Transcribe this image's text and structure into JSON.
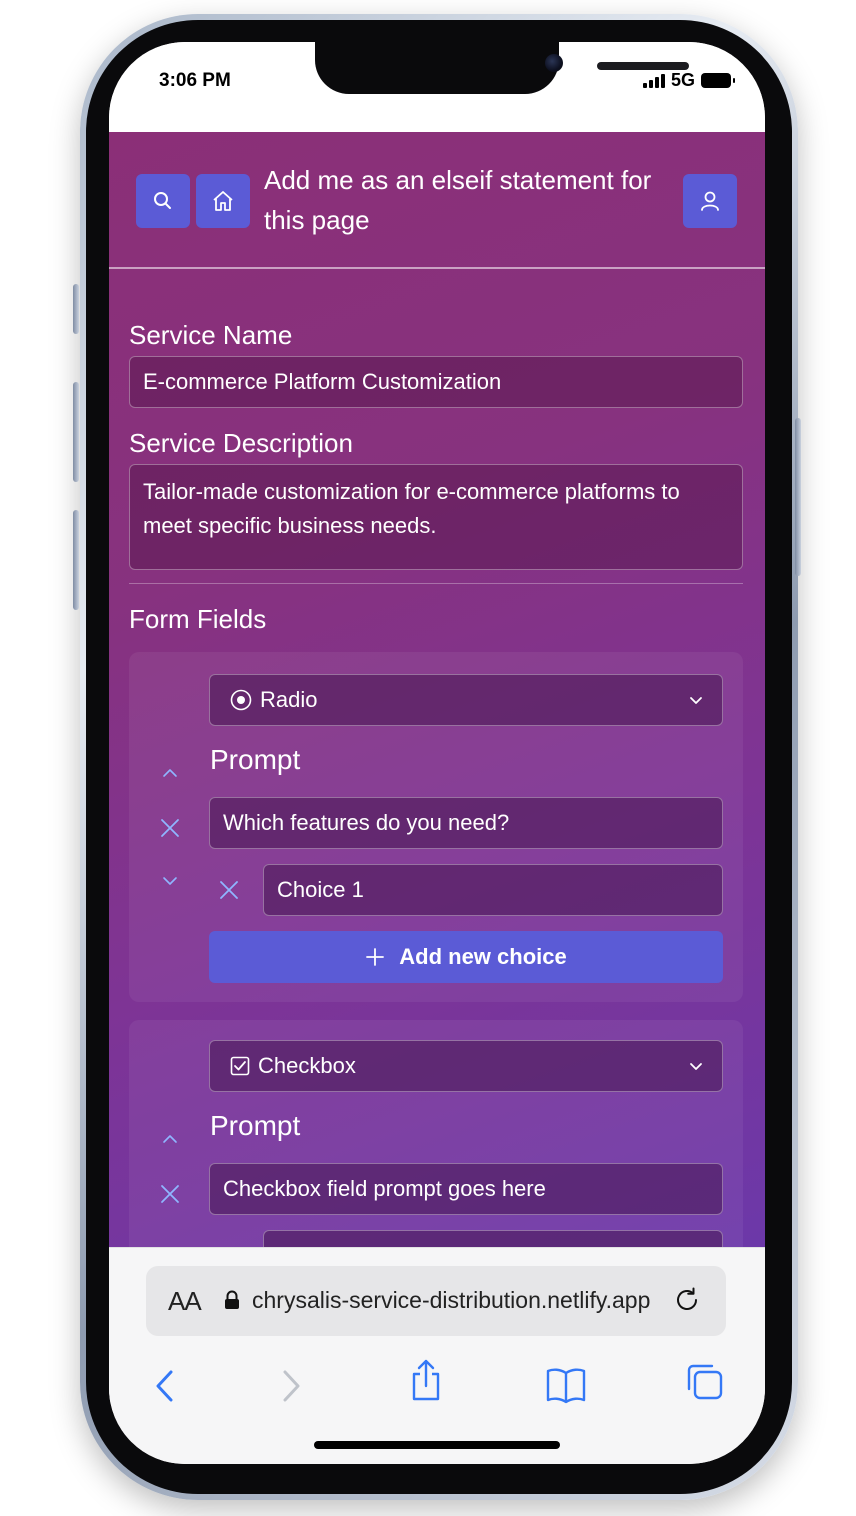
{
  "status_bar": {
    "time": "3:06 PM",
    "network": "5G"
  },
  "header": {
    "title": "Add me as an elseif statement for this page",
    "search_icon": "search-icon",
    "home_icon": "home-icon",
    "user_icon": "user-icon",
    "button_color": "#5b5bd6"
  },
  "form": {
    "service_name_label": "Service Name",
    "service_name_value": "E-commerce Platform Customization",
    "service_description_label": "Service Description",
    "service_description_value": "Tailor-made customization for e-commerce platforms to meet specific business needs.",
    "form_fields_label": "Form Fields"
  },
  "fields": [
    {
      "type_label": "Radio",
      "type_icon": "radio-icon",
      "prompt_label": "Prompt",
      "prompt_value": "Which features do you need?",
      "choices": [
        "Choice 1"
      ],
      "add_choice_label": "Add new choice"
    },
    {
      "type_label": "Checkbox",
      "type_icon": "checkbox-icon",
      "prompt_label": "Prompt",
      "prompt_value": "Checkbox field prompt goes here"
    }
  ],
  "browser": {
    "aa_label": "AA",
    "url": "chrysalis-service-distribution.netlify.app"
  }
}
